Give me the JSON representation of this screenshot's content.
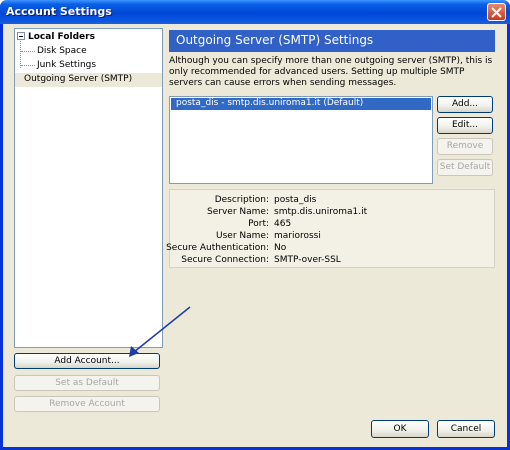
{
  "window": {
    "title": "Account Settings"
  },
  "tree": {
    "root_label": "Local Folders",
    "children": [
      "Disk Space",
      "Junk Settings"
    ],
    "selected_label": "Outgoing Server (SMTP)"
  },
  "left_buttons": {
    "add_account": "Add Account...",
    "set_as_default": "Set as Default",
    "remove_account": "Remove Account"
  },
  "panel": {
    "header": "Outgoing Server (SMTP) Settings",
    "description": "Although you can specify more than one outgoing server (SMTP), this is only recommended for advanced users. Setting up multiple SMTP servers can cause errors when sending messages."
  },
  "server_list": {
    "items": [
      "posta_dis - smtp.dis.uniroma1.it (Default)"
    ]
  },
  "server_buttons": {
    "add": "Add...",
    "edit": "Edit...",
    "remove": "Remove",
    "set_default": "Set Default"
  },
  "details": {
    "rows": [
      {
        "label": "Description:",
        "value": "posta_dis"
      },
      {
        "label": "Server Name:",
        "value": "smtp.dis.uniroma1.it"
      },
      {
        "label": "Port:",
        "value": "465"
      },
      {
        "label": "User Name:",
        "value": "mariorossi"
      },
      {
        "label": "Secure Authentication:",
        "value": "No"
      },
      {
        "label": "Secure Connection:",
        "value": "SMTP-over-SSL"
      }
    ]
  },
  "dialog_buttons": {
    "ok": "OK",
    "cancel": "Cancel"
  },
  "colors": {
    "titlebar": "#0054e3",
    "header_bar": "#3160c6",
    "selection": "#316ac5",
    "annotation_arrow": "#1f3ca8"
  }
}
